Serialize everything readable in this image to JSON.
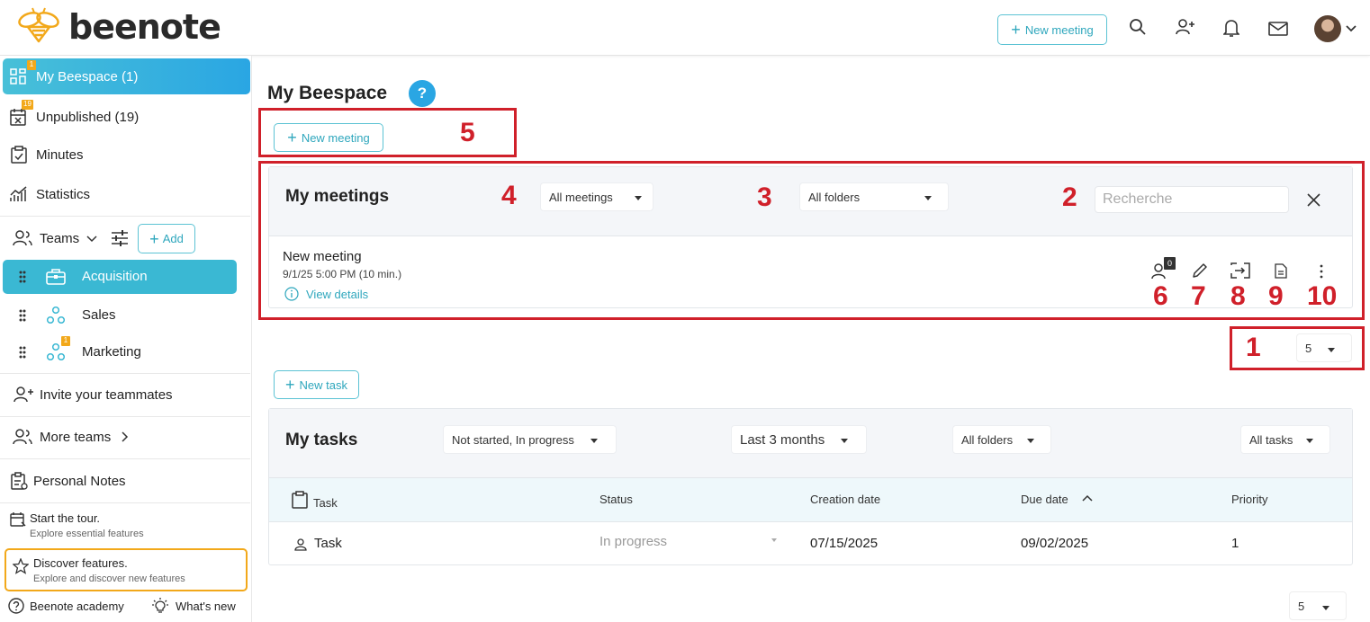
{
  "app": {
    "logo_text": "beenote"
  },
  "header": {
    "new_meeting_label": "New meeting"
  },
  "sidebar": {
    "my_beespace": {
      "label": "My Beespace (1)",
      "badge": "1"
    },
    "unpublished": {
      "label": "Unpublished (19)",
      "badge": "19"
    },
    "minutes": "Minutes",
    "statistics": "Statistics",
    "teams_label": "Teams",
    "add_label": "Add",
    "teams": [
      {
        "label": "Acquisition"
      },
      {
        "label": "Sales"
      },
      {
        "label": "Marketing",
        "badge": "1"
      }
    ],
    "invite": "Invite your teammates",
    "more_teams": "More teams",
    "personal_notes": "Personal Notes",
    "tour": {
      "title": "Start the tour.",
      "subtitle": "Explore essential features"
    },
    "discover": {
      "title": "Discover features.",
      "subtitle": "Explore and discover new features"
    },
    "academy": "Beenote academy",
    "whats_new": "What's new"
  },
  "main": {
    "page_title": "My Beespace",
    "help_symbol": "?",
    "new_meeting_label": "New meeting",
    "meetings": {
      "title": "My meetings",
      "filter_meetings": "All meetings",
      "filter_folders": "All folders",
      "search_placeholder": "Recherche",
      "items": [
        {
          "title": "New meeting",
          "datetime": "9/1/25 5:00 PM (10 min.)",
          "details_label": "View details",
          "participants_count": "0"
        }
      ],
      "page_size": "5"
    },
    "new_task_label": "New task",
    "tasks": {
      "title": "My tasks",
      "filter_status": "Not started, In progress",
      "filter_period": "Last 3 months",
      "filter_folders": "All folders",
      "filter_tasks": "All tasks",
      "columns": [
        "Task",
        "Status",
        "Creation date",
        "Due date",
        "Priority"
      ],
      "rows": [
        {
          "task": "Task",
          "status": "In progress",
          "creation_date": "07/15/2025",
          "due_date": "09/02/2025",
          "priority": "1"
        }
      ],
      "page_size": "5"
    }
  },
  "annotations": [
    "1",
    "2",
    "3",
    "4",
    "5",
    "6",
    "7",
    "8",
    "9",
    "10"
  ],
  "colors": {
    "accent": "#2aa6e3",
    "teal": "#3ab8d3",
    "annotation_red": "#d0202a",
    "badge_orange": "#f2a81a"
  }
}
